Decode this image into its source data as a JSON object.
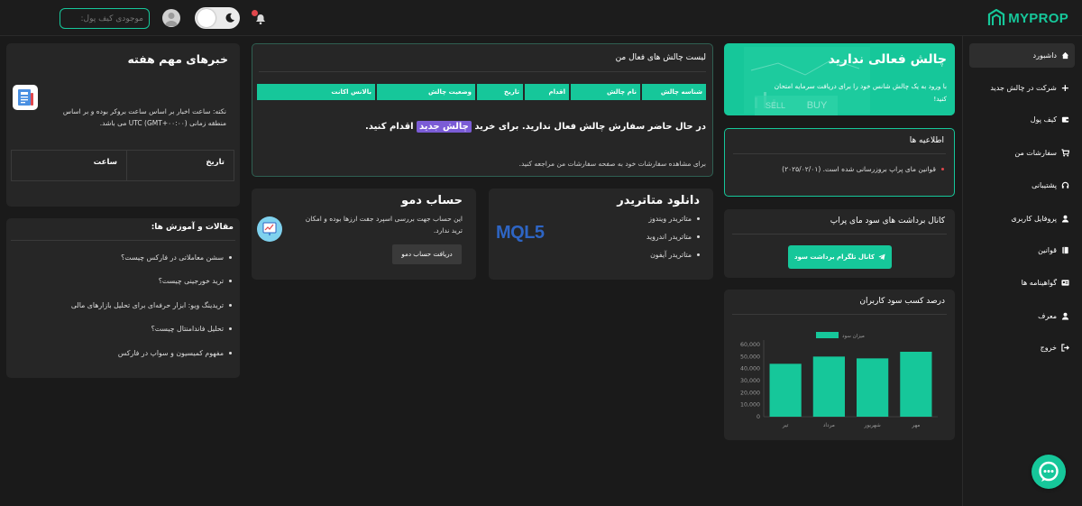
{
  "brand": {
    "name": "MYPROP"
  },
  "header": {
    "wallet_placeholder": "موجودی کیف پول:"
  },
  "sidebar": {
    "items": [
      {
        "label": "داشبورد"
      },
      {
        "label": "شرکت در چالش جدید"
      },
      {
        "label": "کیف پول"
      },
      {
        "label": "سفارشات من"
      },
      {
        "label": "پشتیبانی"
      },
      {
        "label": "پروفایل کاربری"
      },
      {
        "label": "قوانین"
      },
      {
        "label": "گواهینامه ها"
      },
      {
        "label": "معرف"
      },
      {
        "label": "خروج"
      }
    ]
  },
  "hero": {
    "title": "چالش فعالی ندارید",
    "line1": "با ورود به یک چالش شانس خود را برای دریافت سرمایه امتحان",
    "line2": "کنید!",
    "buy": "BUY",
    "sell": "SELL"
  },
  "notices": {
    "title": "اطلاعیه ها",
    "items": [
      {
        "text": "قوانین مای پراپ بروزرسانی شده است. (۲۰۲۵/۰۲/۰۱)"
      }
    ]
  },
  "telegram": {
    "title": "کانال برداشت های سود مای پراپ",
    "button": "کانال تلگرام برداشت سود"
  },
  "profit_chart": {
    "title": "درصد کسب سود کاربران",
    "legend": "میزان سود"
  },
  "chart_data": {
    "type": "bar",
    "categories": [
      "تیر",
      "مرداد",
      "شهریور",
      "مهر"
    ],
    "series": [
      {
        "name": "میزان سود",
        "values": [
          44000,
          50000,
          48500,
          54000
        ]
      }
    ],
    "yticks": [
      "0",
      "10,000",
      "20,000",
      "30,000",
      "40,000",
      "50,000",
      "60,000"
    ],
    "ylim": [
      0,
      60000
    ],
    "grid": false,
    "legend_position": "top",
    "bar_color": "#16c79a"
  },
  "challenges": {
    "title": "لیست چالش های فعال من",
    "columns": [
      "شناسه چالش",
      "نام چالش",
      "اقدام",
      "تاریخ",
      "وضعیت چالش",
      "بالانس اکانت"
    ],
    "empty_before": "در حال حاضر سفارش چالش فعال ندارید. برای خرید",
    "empty_link": "چالش جدید",
    "empty_after": "اقدام کنید.",
    "orders_hint": "برای مشاهده سفارشات خود به صفحه سفارشات من مراجعه کنید."
  },
  "news": {
    "title": "خبرهای مهم هفته",
    "note_line1": "نکته: ساعت اخبار بر اساس ساعت بروکر بوده و بر اساس",
    "note_line2": "منطقه زمانی (GMT+۰۰:۰۰) UTC می باشد.",
    "col_date": "تاریخ",
    "col_time": "ساعت"
  },
  "download": {
    "title": "دانلود متاتریدر",
    "items": [
      {
        "label": "متاتریدر ویندوز"
      },
      {
        "label": "متاتریدر اندروید"
      },
      {
        "label": "متاتریدر آیفون"
      }
    ],
    "logo": "MQL5"
  },
  "demo": {
    "title": "حساب دمو",
    "line1": "این حساب جهت بررسی اسپرد جفت ارزها بوده و امکان",
    "line2": "ترید ندارد.",
    "button": "دریافت حساب دمو"
  },
  "articles": {
    "title": "مقالات و آموزش ها:",
    "items": [
      {
        "label": "سشن معاملاتی در فارکس چیست؟"
      },
      {
        "label": "ترید خورجینی چیست؟"
      },
      {
        "label": "تریدینگ ویو: ابزار حرفه‌ای برای تحلیل بازارهای مالی"
      },
      {
        "label": "تحلیل فاندامنتال چیست؟"
      },
      {
        "label": "مفهوم کمیسیون و سواپ در فارکس"
      }
    ]
  },
  "colors": {
    "accent": "#16c79a",
    "background": "#1a1a1a",
    "card": "#262626",
    "highlight": "#7b5cd6"
  }
}
